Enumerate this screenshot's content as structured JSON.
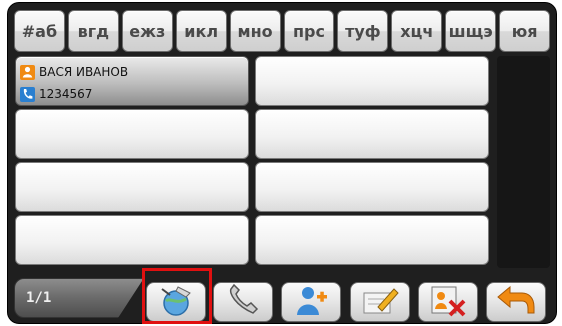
{
  "alphabet": [
    {
      "label": "#аб"
    },
    {
      "label": "вгд"
    },
    {
      "label": "ежз"
    },
    {
      "label": "икл"
    },
    {
      "label": "мно"
    },
    {
      "label": "прс"
    },
    {
      "label": "туф"
    },
    {
      "label": "хцч"
    },
    {
      "label": "шщэ"
    },
    {
      "label": "юя"
    }
  ],
  "contacts": [
    {
      "name": "ВАСЯ ИВАНОВ",
      "phone": "1234567",
      "selected": true
    }
  ],
  "pager": {
    "text": "1/1"
  },
  "toolbar": [
    {
      "icon": "call-globe-icon"
    },
    {
      "icon": "phone-handset-icon"
    },
    {
      "icon": "add-contact-icon"
    },
    {
      "icon": "edit-pencil-icon"
    },
    {
      "icon": "delete-contact-icon"
    },
    {
      "icon": "back-arrow-icon"
    }
  ],
  "colors": {
    "highlight": "#e01010",
    "person_icon": "#f08a12",
    "phone_icon": "#2a7fd0",
    "background": "#1f1f1f"
  }
}
